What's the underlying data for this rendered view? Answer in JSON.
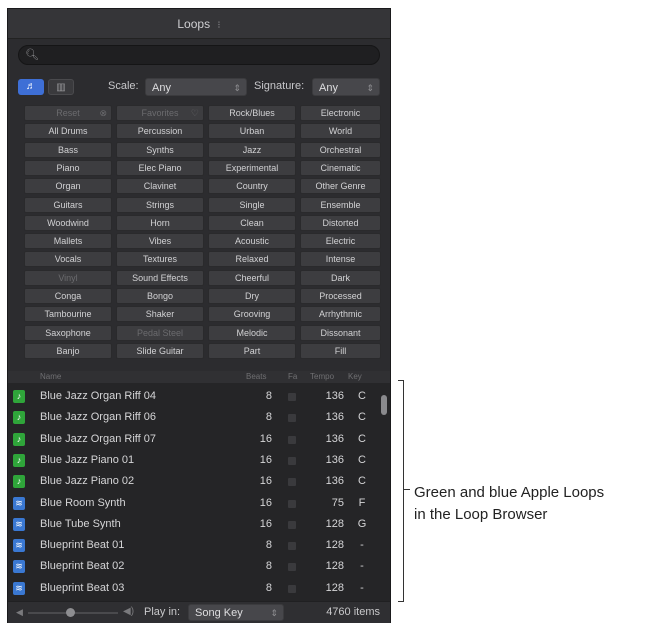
{
  "window": {
    "title": "Loops",
    "title_chevron": "⁝"
  },
  "search": {
    "icon": "search-icon",
    "placeholder": ""
  },
  "view_buttons": {
    "music": "♬",
    "columns": "▥"
  },
  "filters": {
    "scale_label": "Scale:",
    "scale_value": "Any",
    "signature_label": "Signature:",
    "signature_value": "Any"
  },
  "keywords": [
    [
      "Reset",
      "Favorites",
      "Rock/Blues",
      "Electronic"
    ],
    [
      "All Drums",
      "Percussion",
      "Urban",
      "World"
    ],
    [
      "Bass",
      "Synths",
      "Jazz",
      "Orchestral"
    ],
    [
      "Piano",
      "Elec Piano",
      "Experimental",
      "Cinematic"
    ],
    [
      "Organ",
      "Clavinet",
      "Country",
      "Other Genre"
    ],
    [
      "Guitars",
      "Strings",
      "Single",
      "Ensemble"
    ],
    [
      "Woodwind",
      "Horn",
      "Clean",
      "Distorted"
    ],
    [
      "Mallets",
      "Vibes",
      "Acoustic",
      "Electric"
    ],
    [
      "Vocals",
      "Textures",
      "Relaxed",
      "Intense"
    ],
    [
      "Vinyl",
      "Sound Effects",
      "Cheerful",
      "Dark"
    ],
    [
      "Conga",
      "Bongo",
      "Dry",
      "Processed"
    ],
    [
      "Tambourine",
      "Shaker",
      "Grooving",
      "Arrhythmic"
    ],
    [
      "Saxophone",
      "Pedal Steel",
      "Melodic",
      "Dissonant"
    ],
    [
      "Banjo",
      "Slide Guitar",
      "Part",
      "Fill"
    ]
  ],
  "list": {
    "columns": {
      "name": "Name",
      "beats": "Beats",
      "fav": "Fa",
      "tempo": "Tempo",
      "key": "Key"
    },
    "rows": [
      {
        "type": "green",
        "name": "Blue Jazz Organ Riff 04",
        "beats": "8",
        "tempo": "136",
        "key": "C"
      },
      {
        "type": "green",
        "name": "Blue Jazz Organ Riff 06",
        "beats": "8",
        "tempo": "136",
        "key": "C"
      },
      {
        "type": "green",
        "name": "Blue Jazz Organ Riff 07",
        "beats": "16",
        "tempo": "136",
        "key": "C"
      },
      {
        "type": "green",
        "name": "Blue Jazz Piano 01",
        "beats": "16",
        "tempo": "136",
        "key": "C"
      },
      {
        "type": "green",
        "name": "Blue Jazz Piano 02",
        "beats": "16",
        "tempo": "136",
        "key": "C"
      },
      {
        "type": "blue",
        "name": "Blue Room Synth",
        "beats": "16",
        "tempo": "75",
        "key": "F"
      },
      {
        "type": "blue",
        "name": "Blue Tube Synth",
        "beats": "16",
        "tempo": "128",
        "key": "G"
      },
      {
        "type": "blue",
        "name": "Blueprint Beat 01",
        "beats": "8",
        "tempo": "128",
        "key": "-"
      },
      {
        "type": "blue",
        "name": "Blueprint Beat 02",
        "beats": "8",
        "tempo": "128",
        "key": "-"
      },
      {
        "type": "blue",
        "name": "Blueprint Beat 03",
        "beats": "8",
        "tempo": "128",
        "key": "-"
      }
    ]
  },
  "footer": {
    "play_in_label": "Play in:",
    "play_in_value": "Song Key",
    "count": "4760 items"
  },
  "callout": {
    "line1": "Green and blue Apple Loops",
    "line2": "in the Loop Browser"
  },
  "colors": {
    "green_loop": "#2fa53a",
    "blue_loop": "#3a78d2",
    "accent": "#3e6fd6"
  }
}
